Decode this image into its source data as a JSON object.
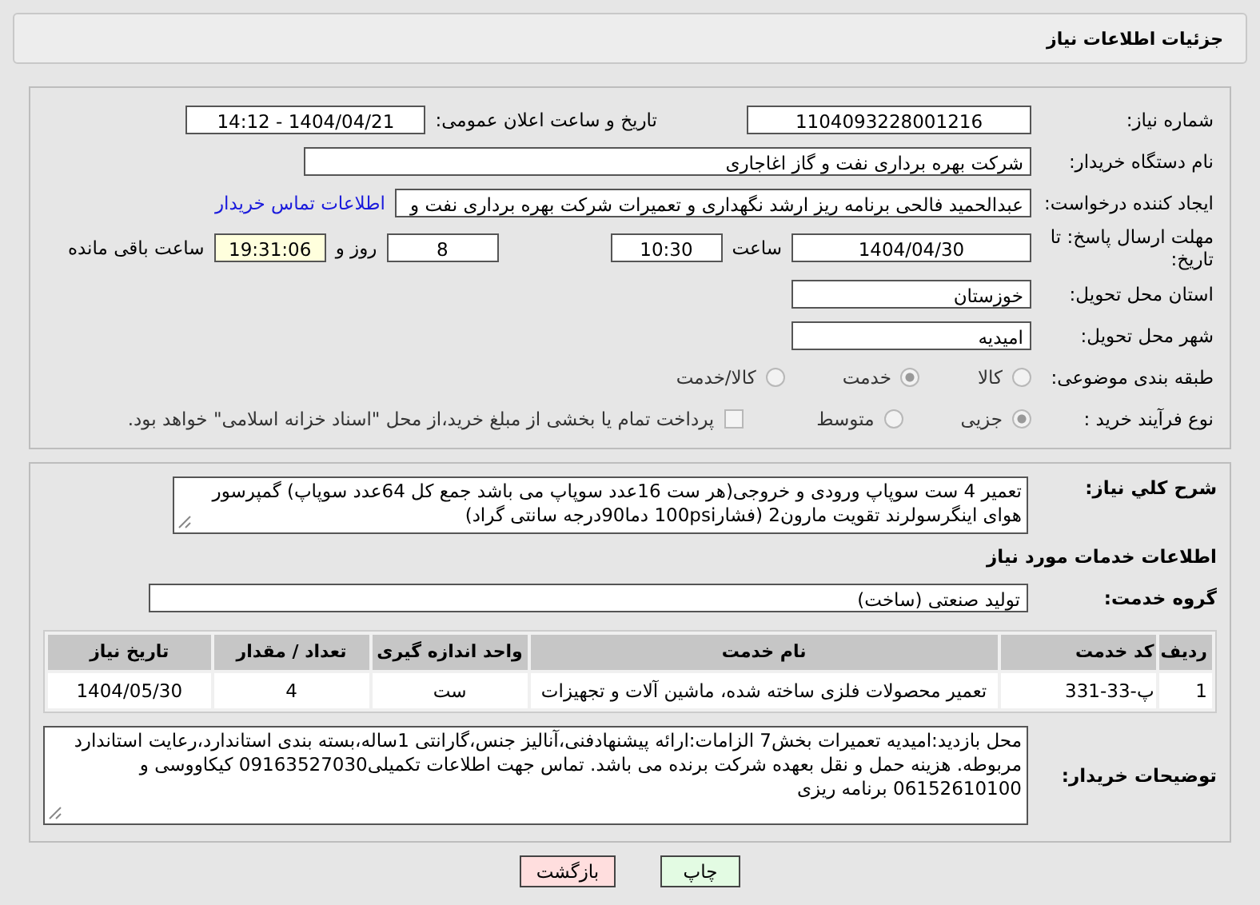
{
  "header": {
    "title": "جزئیات اطلاعات نیاز"
  },
  "need_number": {
    "label": "شماره نیاز:",
    "value": "1104093228001216"
  },
  "announce": {
    "label": "تاریخ و ساعت اعلان عمومی:",
    "value": "1404/04/21 - 14:12"
  },
  "buyer_org": {
    "label": "نام دستگاه خریدار:",
    "value": "شرکت بهره برداری نفت و گاز اغاجاری"
  },
  "requester": {
    "label": "ایجاد کننده درخواست:",
    "value": "عبدالحمید فالحی برنامه ریز ارشد نگهداری و تعمیرات شرکت بهره برداری نفت و",
    "link": "اطلاعات تماس خریدار"
  },
  "deadline": {
    "label": "مهلت ارسال پاسخ: تا تاریخ:",
    "date": "1404/04/30",
    "time_label": "ساعت",
    "time": "10:30",
    "days": "8",
    "days_label": "روز و",
    "remaining": "19:31:06",
    "remaining_label": "ساعت باقی مانده"
  },
  "province": {
    "label": "استان محل تحویل:",
    "value": "خوزستان"
  },
  "city": {
    "label": "شهر محل تحویل:",
    "value": "امیدیه"
  },
  "category": {
    "label": "طبقه بندی موضوعی:",
    "options": [
      {
        "label": "کالا",
        "selected": false
      },
      {
        "label": "خدمت",
        "selected": true
      },
      {
        "label": "کالا/خدمت",
        "selected": false
      }
    ]
  },
  "process": {
    "label": "نوع فرآیند خرید :",
    "options": [
      {
        "label": "جزیی",
        "selected": true
      },
      {
        "label": "متوسط",
        "selected": false
      }
    ],
    "payment": {
      "label": "پرداخت تمام یا بخشی از مبلغ خرید،از محل \"اسناد خزانه اسلامی\" خواهد بود.",
      "checked": false
    }
  },
  "description": {
    "label": "شرح کلي نياز:",
    "value": "تعمیر 4 ست سوپاپ  ورودی و خروجی(هر ست 16عدد سوپاپ می باشد جمع کل 64عدد سوپاپ) گمپرسور هوای اینگرسولرند تقویت مارون2 (فشار100psi دما90درجه سانتی گراد)"
  },
  "services_heading": "اطلاعات خدمات مورد نیاز",
  "service_group": {
    "label": "گروه خدمت:",
    "value": "تولید صنعتی (ساخت)"
  },
  "table": {
    "columns": [
      "ردیف",
      "کد خدمت",
      "نام خدمت",
      "واحد اندازه گیری",
      "تعداد / مقدار",
      "تاریخ نیاز"
    ],
    "rows": [
      [
        "1",
        "پ-33-331",
        "تعمیر محصولات فلزی ساخته شده، ماشین آلات و تجهیزات",
        "ست",
        "4",
        "1404/05/30"
      ]
    ]
  },
  "buyer_notes": {
    "label": "توضیحات خریدار:",
    "value": "محل بازدید:امیدیه تعمیرات بخش7 الزامات:ارائه پیشنهادفنی،آنالیز جنس،گارانتی 1ساله،بسته بندی استاندارد،رعایت استاندارد مربوطه. هزینه حمل و نقل بعهده شرکت برنده می باشد. تماس جهت اطلاعات تکمیلی09163527030 کیکاووسی و 06152610100 برنامه ریزی"
  },
  "buttons": [
    {
      "label": "چاپ",
      "kind": "print"
    },
    {
      "label": "بازگشت",
      "kind": "back"
    }
  ]
}
